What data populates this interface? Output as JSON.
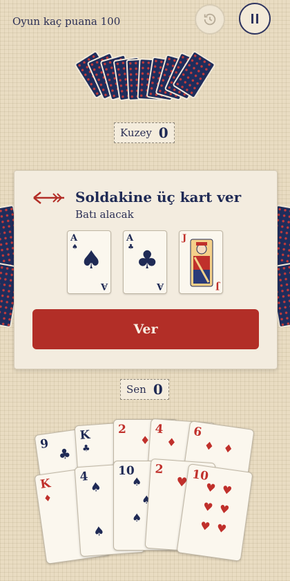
{
  "header": {
    "target_label": "Oyun kaç puana 100",
    "history_icon": "history-icon",
    "pause_icon": "pause-icon"
  },
  "players": {
    "north": {
      "label": "Kuzey",
      "score": "0"
    },
    "self": {
      "label": "Sen",
      "score": "0"
    }
  },
  "pass_dialog": {
    "title": "Soldakine üç kart ver",
    "subtitle": "Batı alacak",
    "cards": [
      {
        "rank": "A",
        "suit": "♠",
        "color": "#1f2a55"
      },
      {
        "rank": "A",
        "suit": "♣",
        "color": "#1f2a55"
      },
      {
        "rank": "J",
        "suit": "♥",
        "color": "#c0302b"
      }
    ],
    "give_label": "Ver"
  },
  "hand": {
    "back_row": [
      {
        "rank": "9",
        "suit": "♣",
        "color": "#1f2a55"
      },
      {
        "rank": "K",
        "suit": "♣",
        "color": "#1f2a55"
      },
      {
        "rank": "2",
        "suit": "♦",
        "color": "#c0302b"
      },
      {
        "rank": "4",
        "suit": "♦",
        "color": "#c0302b"
      },
      {
        "rank": "6",
        "suit": "♦",
        "color": "#c0302b"
      }
    ],
    "front_row": [
      {
        "rank": "K",
        "suit": "♦",
        "color": "#c0302b"
      },
      {
        "rank": "4",
        "suit": "♠",
        "color": "#1f2a55"
      },
      {
        "rank": "10",
        "suit": "♠",
        "color": "#1f2a55"
      },
      {
        "rank": "2",
        "suit": "♥",
        "color": "#c0302b"
      },
      {
        "rank": "10",
        "suit": "♥",
        "color": "#c0302b"
      }
    ]
  }
}
